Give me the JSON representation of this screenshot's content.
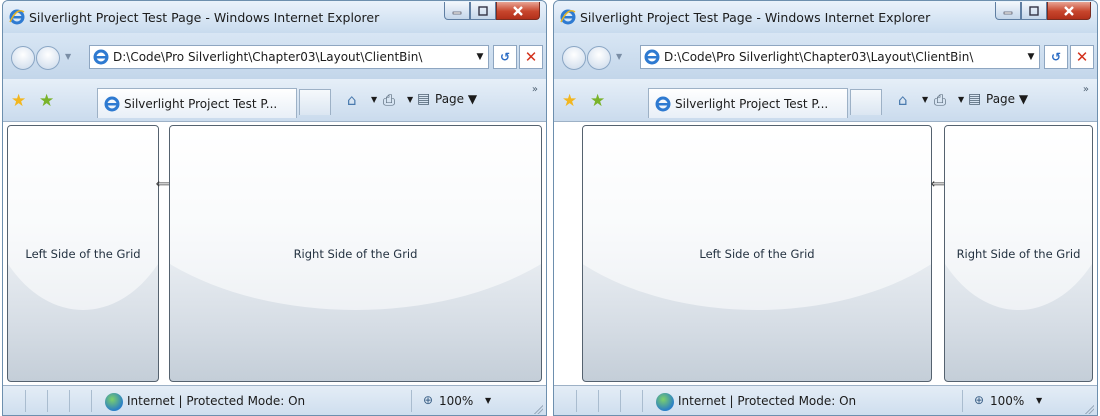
{
  "windows": [
    {
      "title": "Silverlight Project Test Page - Windows Internet Explorer",
      "address": "D:\\Code\\Pro Silverlight\\Chapter03\\Layout\\ClientBin\\",
      "tab_title": "Silverlight Project Test P...",
      "page_menu": "Page",
      "grid": {
        "left_label": "Left Side of the Grid",
        "right_label": "Right Side of the Grid"
      },
      "status": {
        "zone": "Internet | Protected Mode: On",
        "zoom": "100%"
      }
    },
    {
      "title": "Silverlight Project Test Page - Windows Internet Explorer",
      "address": "D:\\Code\\Pro Silverlight\\Chapter03\\Layout\\ClientBin\\",
      "tab_title": "Silverlight Project Test P...",
      "page_menu": "Page",
      "grid": {
        "left_label": "Left Side of the Grid",
        "right_label": "Right Side of the Grid"
      },
      "status": {
        "zone": "Internet | Protected Mode: On",
        "zoom": "100%"
      }
    }
  ],
  "icons": {
    "app": "internet-explorer-icon",
    "back": "back-icon",
    "forward": "forward-icon",
    "refresh": "refresh-icon",
    "stop": "stop-icon",
    "favorites": "favorites-star-icon",
    "add_favorite": "add-favorite-icon",
    "home": "home-icon",
    "print": "print-icon",
    "page": "page-icon",
    "globe": "internet-zone-icon",
    "zoom": "zoom-icon",
    "splitter": "resize-horizontal-icon"
  },
  "colors": {
    "close_button": "#c7452c",
    "chrome": "#c9dcee"
  }
}
